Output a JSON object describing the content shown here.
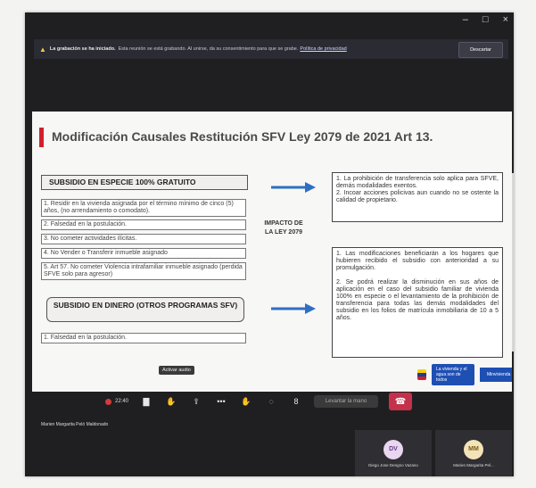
{
  "window": {
    "minimize": "–",
    "maximize": "□",
    "close": "×"
  },
  "recording_banner": {
    "title": "La grabación se ha iniciado.",
    "text": "Esta reunión se está grabando. Al unirse, da su consentimiento para que se grabe.",
    "link": "Política de privacidad",
    "dismiss": "Descartar"
  },
  "slide": {
    "title": "Modificación Causales Restitución SFV Ley 2079 de 2021 Art 13.",
    "in_kind_header": "SUBSIDIO EN ESPECIE 100% GRATUITO",
    "in_kind_items": [
      "1. Residir en la vivienda asignada por el término mínimo de cinco (5) años, (no arrendamiento o comodato).",
      "2. Falsedad en la postulación.",
      "3. No cometer actividades ilícitas.",
      "4. No Vender o Transferir inmueble asignado",
      "5. Art 57. No cometer Violencia intrafamiliar inmueble asignado (perdida SFVE solo para agresor)"
    ],
    "cash_header": "SUBSIDIO EN DINERO (OTROS PROGRAMAS SFV)",
    "cash_items": [
      "1. Falsedad en la postulación."
    ],
    "impact_label": "IMPACTO DE LA LEY 2079",
    "top_right_text": "1. La prohibición de transferencia solo aplica para SFVE, demás modalidades exentos.\n2. Incoar acciones policivas aun cuando no se ostente la calidad de propietario.",
    "bottom_right_text": "1. Las modificaciones beneficiarán a los hogares que hubieren recibido el subsidio con anterioridad a su promulgación.\n\n2. Se podrá realizar la disminución en sus años de aplicación en el caso del subsidio familiar de vivienda 100% en especie o el levantamiento de la prohibición de transferencia para todas las demás modalidades del subsidio en los folios de matrícula inmobiliaria de 10 a 5 años.",
    "logo_text": "La vivienda y el agua son de todos",
    "ministry_text": "Minvivienda"
  },
  "meeting": {
    "timer": "22:40",
    "tooltip": "Activar audio",
    "raise_hand": "Levantar la mano",
    "presenter": "Marien Margarita Peló Maldonado"
  },
  "participants": [
    {
      "initials": "DV",
      "name": "Diego Jose Dengno Vazano",
      "bg": "#e9d6f0",
      "fg": "#6a3d85"
    },
    {
      "initials": "MM",
      "name": "Marien Margarita Pel...",
      "bg": "#f3e3b8",
      "fg": "#7a5a12"
    }
  ],
  "colors": {
    "accent_red": "#d0202f",
    "arrow_blue": "#2f6fc3",
    "hangup": "#c4314b"
  }
}
